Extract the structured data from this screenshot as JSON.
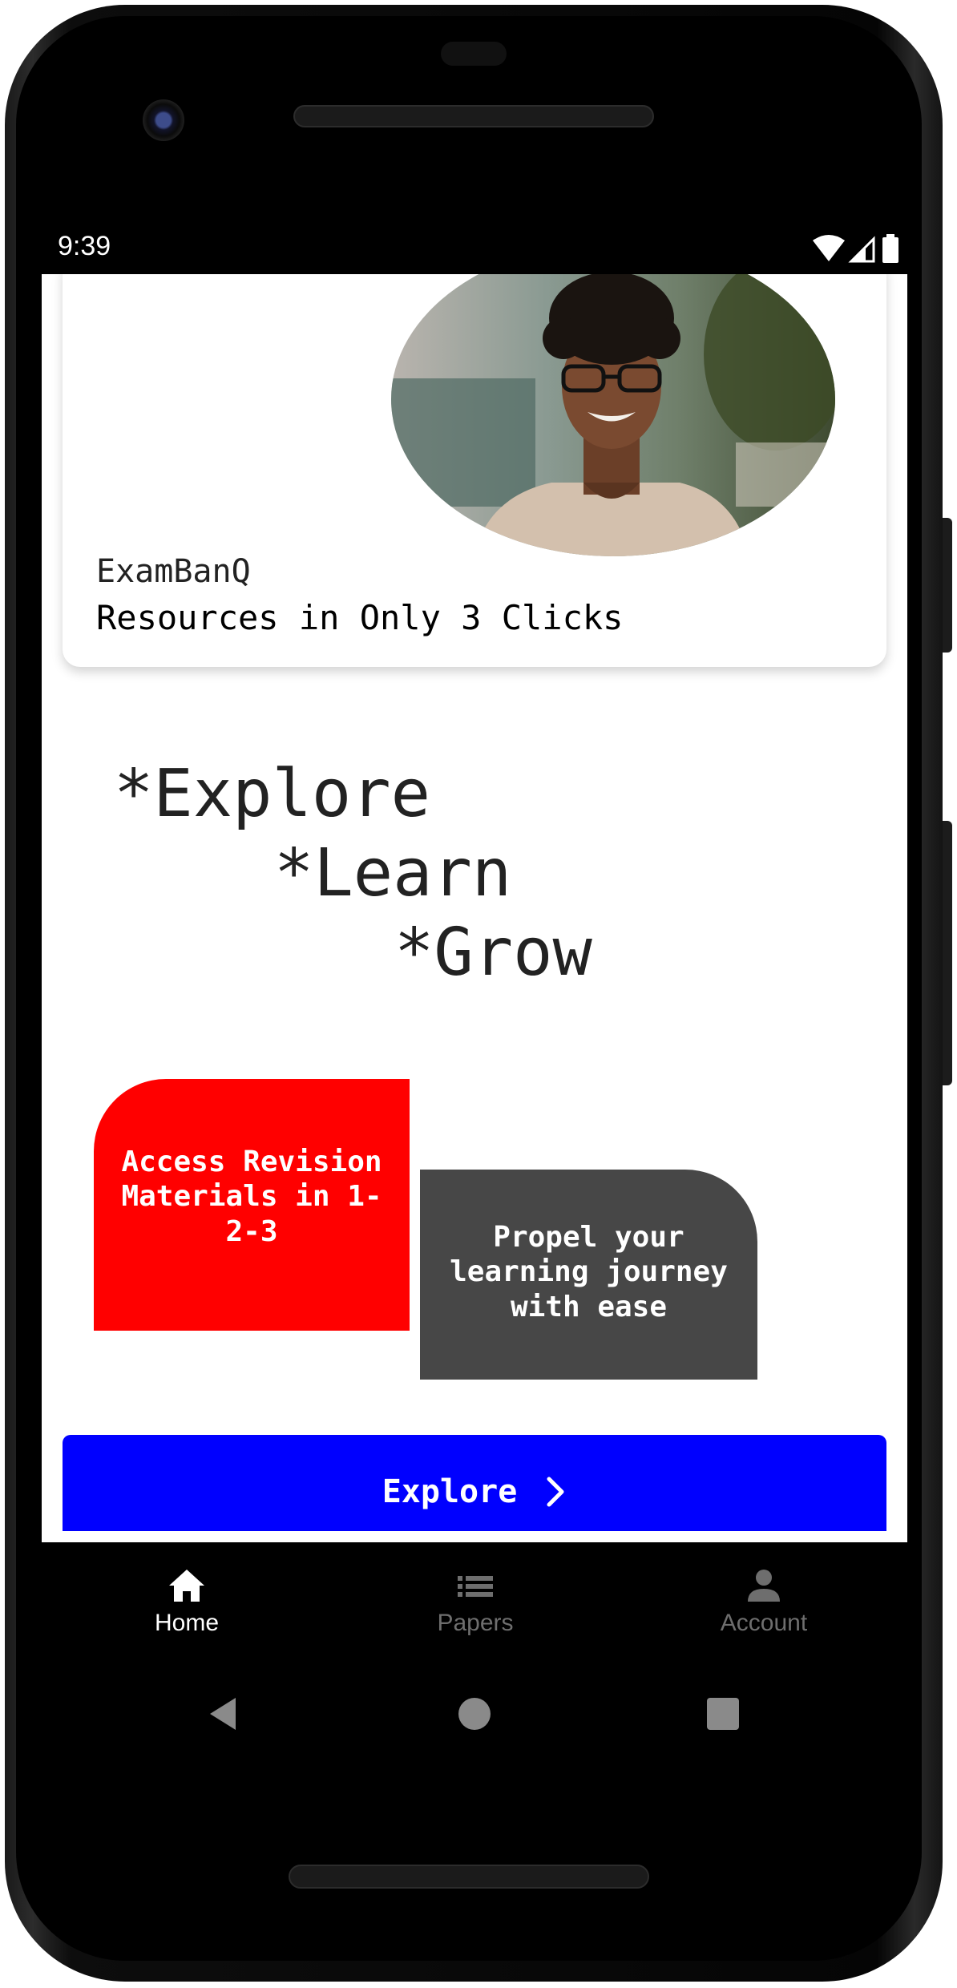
{
  "status_bar": {
    "time": "9:39"
  },
  "hero": {
    "brand": "ExamBanQ",
    "tagline": "Resources in Only 3 Clicks"
  },
  "motto": {
    "line1": "*Explore",
    "line2": "*Learn",
    "line3": "*Grow"
  },
  "tiles": {
    "revision": {
      "text": "Access Revision Materials in 1-2-3",
      "color": "#ff0000"
    },
    "propel": {
      "text": "Propel your learning journey with ease",
      "color": "#474747"
    }
  },
  "explore_button": {
    "label": "Explore",
    "color": "#0000ff"
  },
  "bottom_nav": {
    "items": [
      {
        "label": "Home",
        "icon": "home-icon",
        "active": true
      },
      {
        "label": "Papers",
        "icon": "list-icon",
        "active": false
      },
      {
        "label": "Account",
        "icon": "person-icon",
        "active": false
      }
    ],
    "active_color": "#ffffff",
    "inactive_color": "#6e6e6e"
  }
}
